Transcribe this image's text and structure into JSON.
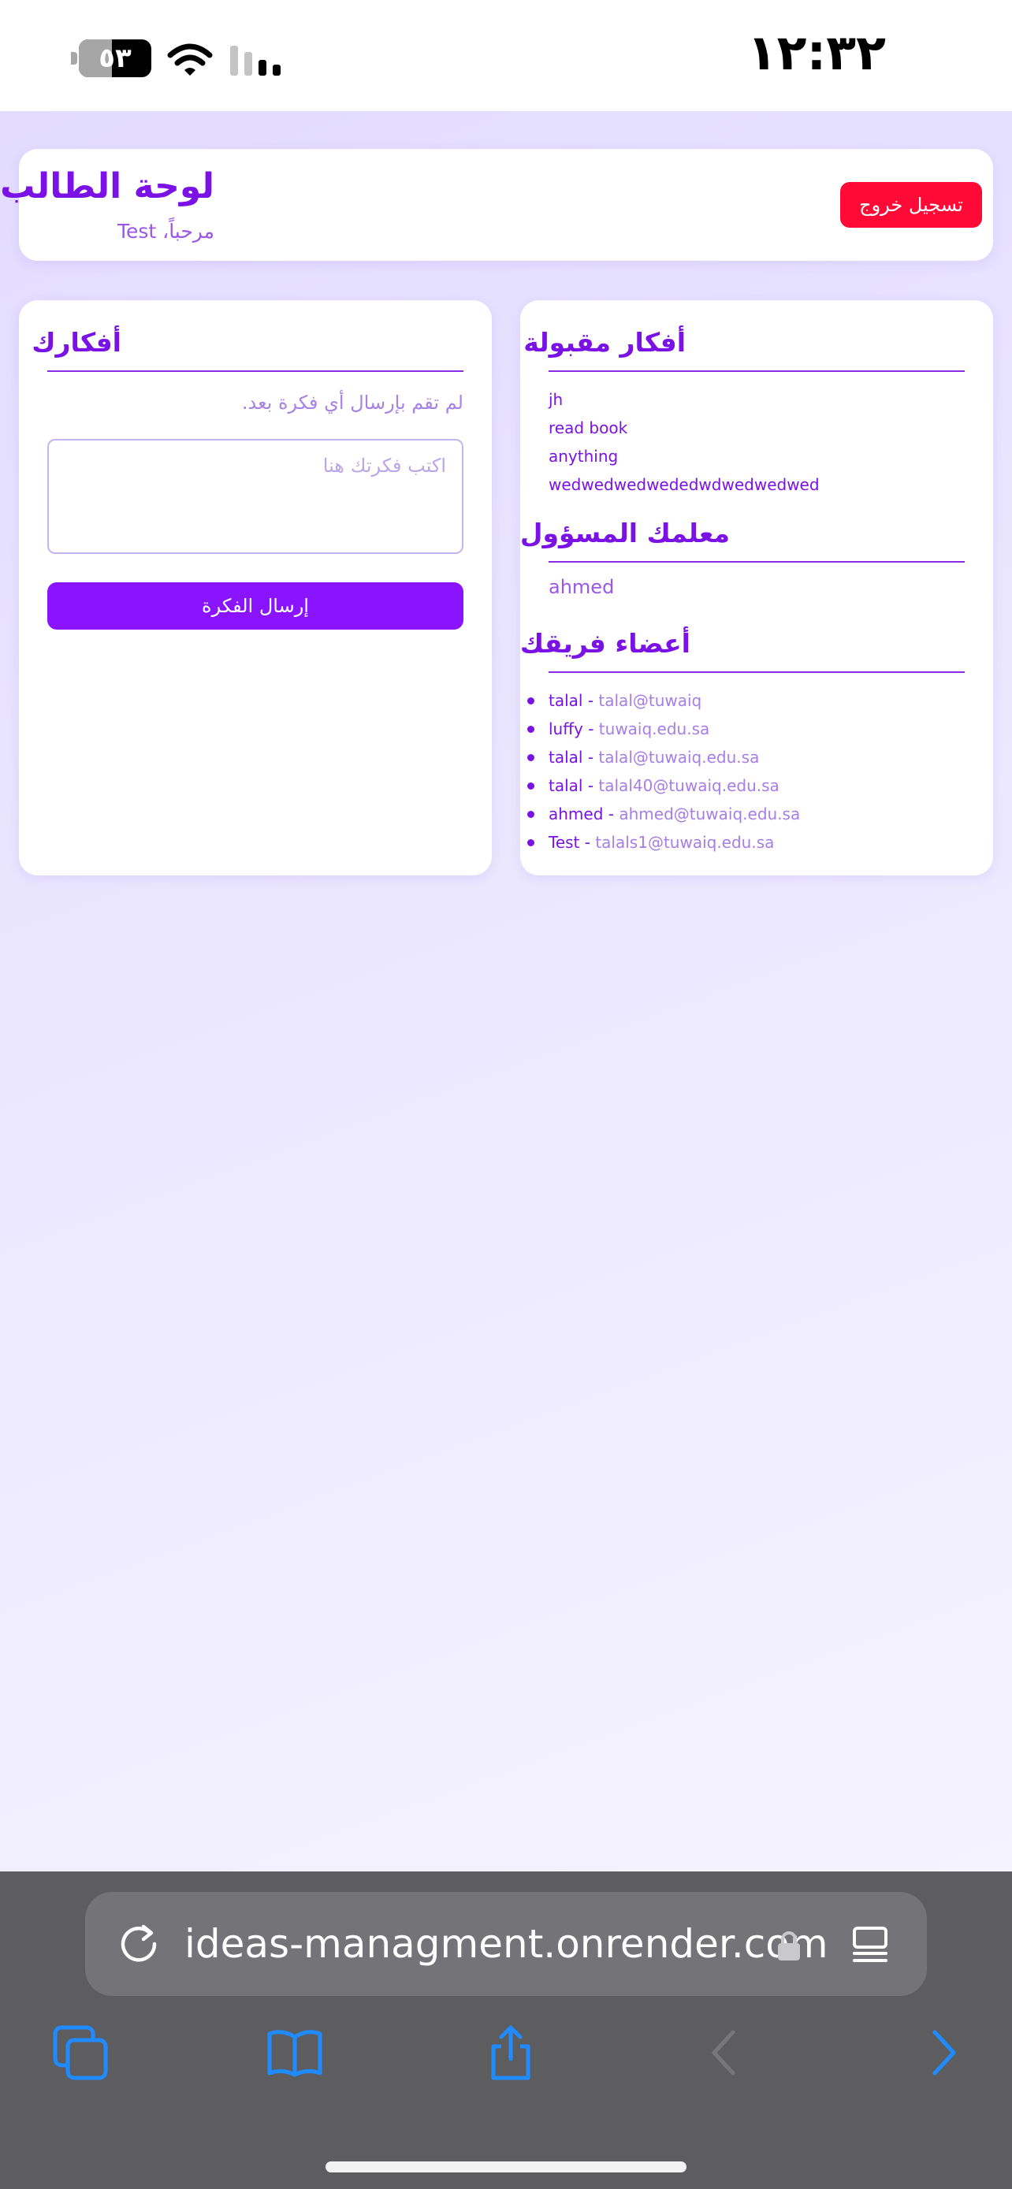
{
  "status_bar": {
    "time": "١٢:٣٢",
    "battery_level": "٥٣"
  },
  "header": {
    "title": "لوحة الطالب",
    "welcome": "مرحباً، Test",
    "logout_label": "تسجيل خروج"
  },
  "my_ideas": {
    "title": "أفكارك",
    "empty_message": "لم تقم بإرسال أي فكرة بعد.",
    "input_placeholder": "اكتب فكرتك هنا",
    "input_value": "",
    "submit_label": "إرسال الفكرة"
  },
  "accepted_ideas": {
    "title": "أفكار مقبولة",
    "items": [
      "jh",
      "read book",
      "anything",
      "wedwedwedwededwdwedwedwed"
    ]
  },
  "teacher": {
    "title": "معلمك المسؤول",
    "name": "ahmed"
  },
  "team": {
    "title": "أعضاء فريقك",
    "separator": " - ",
    "members": [
      {
        "name": "talal",
        "email": "talal@tuwaiq"
      },
      {
        "name": "luffy",
        "email": "tuwaiq.edu.sa"
      },
      {
        "name": "talal",
        "email": "talal@tuwaiq.edu.sa"
      },
      {
        "name": "talal",
        "email": "talal40@tuwaiq.edu.sa"
      },
      {
        "name": "ahmed",
        "email": "ahmed@tuwaiq.edu.sa"
      },
      {
        "name": "Test",
        "email": "talals1@tuwaiq.edu.sa"
      }
    ]
  },
  "browser": {
    "url": "ideas-managment.onrender.com",
    "icons": [
      "reload-icon",
      "lock-icon",
      "reader-icon",
      "tabs-icon",
      "bookmarks-icon",
      "share-icon",
      "back-icon",
      "forward-icon"
    ]
  }
}
